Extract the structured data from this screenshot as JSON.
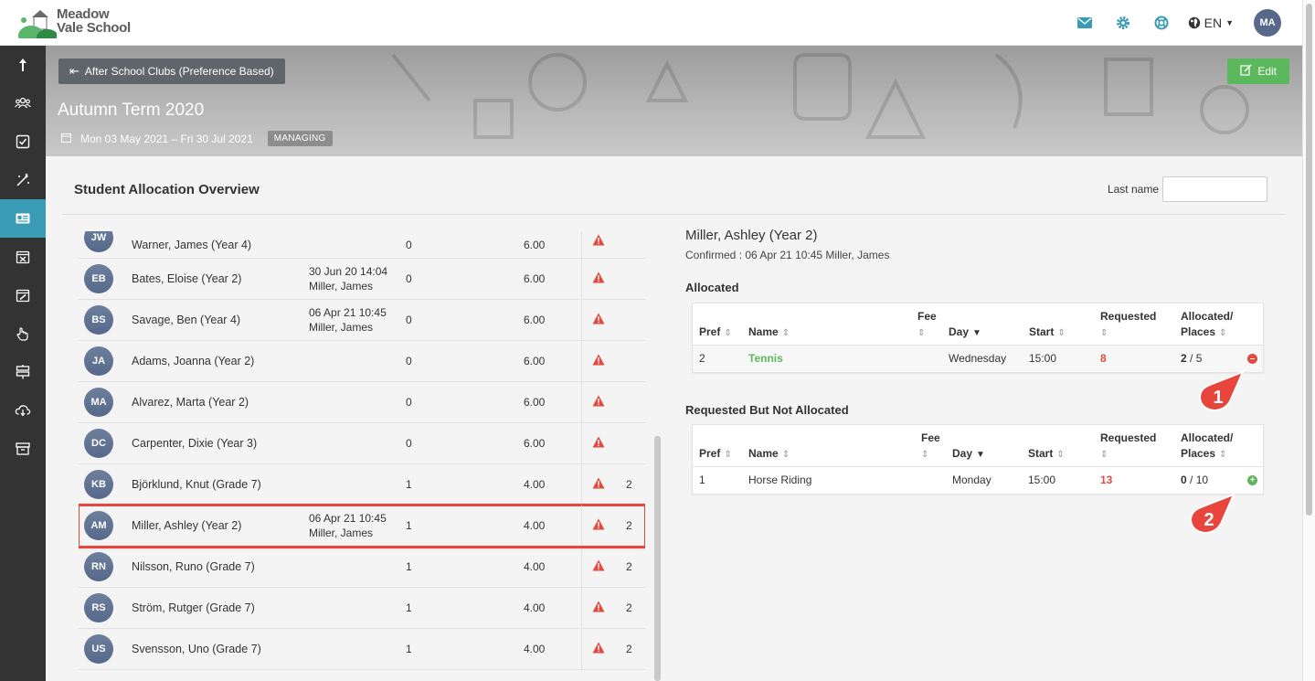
{
  "header": {
    "logo_line1": "Meadow",
    "logo_line2": "Vale School",
    "language": "EN",
    "user_initials": "MA"
  },
  "banner": {
    "back_label": "After School Clubs (Preference Based)",
    "edit_label": "Edit",
    "title": "Autumn Term 2020",
    "date_range": "Mon 03 May 2021 – Fri 30 Jul 2021",
    "status_badge": "MANAGING"
  },
  "overview": {
    "title": "Student Allocation Overview",
    "filter_label": "Last name",
    "filter_value": ""
  },
  "students": [
    {
      "initials": "JW",
      "name": "Warner, James (Year 4)",
      "confirmed_date": "",
      "confirmed_by": "",
      "allocated": "0",
      "fee": "6.00",
      "extra": ""
    },
    {
      "initials": "EB",
      "name": "Bates, Eloise (Year 2)",
      "confirmed_date": "30 Jun 20 14:04",
      "confirmed_by": "Miller, James",
      "allocated": "0",
      "fee": "6.00",
      "extra": ""
    },
    {
      "initials": "BS",
      "name": "Savage, Ben (Year 4)",
      "confirmed_date": "06 Apr 21 10:45",
      "confirmed_by": "Miller, James",
      "allocated": "0",
      "fee": "6.00",
      "extra": ""
    },
    {
      "initials": "JA",
      "name": "Adams, Joanna (Year 2)",
      "confirmed_date": "",
      "confirmed_by": "",
      "allocated": "0",
      "fee": "6.00",
      "extra": ""
    },
    {
      "initials": "MA",
      "name": "Alvarez, Marta (Year 2)",
      "confirmed_date": "",
      "confirmed_by": "",
      "allocated": "0",
      "fee": "6.00",
      "extra": ""
    },
    {
      "initials": "DC",
      "name": "Carpenter, Dixie (Year 3)",
      "confirmed_date": "",
      "confirmed_by": "",
      "allocated": "0",
      "fee": "6.00",
      "extra": ""
    },
    {
      "initials": "KB",
      "name": "Björklund, Knut (Grade 7)",
      "confirmed_date": "",
      "confirmed_by": "",
      "allocated": "1",
      "fee": "4.00",
      "extra": "2"
    },
    {
      "initials": "AM",
      "name": "Miller, Ashley (Year 2)",
      "confirmed_date": "06 Apr 21 10:45",
      "confirmed_by": "Miller, James",
      "allocated": "1",
      "fee": "4.00",
      "extra": "2"
    },
    {
      "initials": "RN",
      "name": "Nilsson, Runo (Grade 7)",
      "confirmed_date": "",
      "confirmed_by": "",
      "allocated": "1",
      "fee": "4.00",
      "extra": "2"
    },
    {
      "initials": "RS",
      "name": "Ström, Rutger (Grade 7)",
      "confirmed_date": "",
      "confirmed_by": "",
      "allocated": "1",
      "fee": "4.00",
      "extra": "2"
    },
    {
      "initials": "US",
      "name": "Svensson, Uno (Grade 7)",
      "confirmed_date": "",
      "confirmed_by": "",
      "allocated": "1",
      "fee": "4.00",
      "extra": "2"
    }
  ],
  "selected_index": 7,
  "detail": {
    "student_name": "Miller, Ashley (Year 2)",
    "confirmed_text": "Confirmed : 06 Apr 21 10:45 Miller, James",
    "allocated_title": "Allocated",
    "not_allocated_title": "Requested But Not Allocated",
    "columns": {
      "pref": "Pref",
      "name": "Name",
      "fee": "Fee",
      "day": "Day",
      "start": "Start",
      "requested": "Requested",
      "allocated_places_1": "Allocated/",
      "allocated_places_2": "Places"
    },
    "allocated_row": {
      "pref": "2",
      "name": "Tennis",
      "day": "Wednesday",
      "start": "15:00",
      "requested": "8",
      "allocated": "2",
      "places": "/ 5"
    },
    "not_allocated_row": {
      "pref": "1",
      "name": "Horse Riding",
      "day": "Monday",
      "start": "15:00",
      "requested": "13",
      "allocated": "0",
      "places": "/ 10"
    }
  },
  "markers": [
    "1",
    "2"
  ],
  "colors": {
    "sidebar": "#333333",
    "sidebar_active": "#3a9bb5",
    "edit_green": "#5cb85c",
    "alert_red": "#e04a3f",
    "avatar": "#56698a",
    "header_icon": "#3a9bb5"
  },
  "icons": {
    "sidebar": [
      "upload-icon",
      "people-icon",
      "checkbox-icon",
      "magic-wand-icon",
      "id-card-icon",
      "calendar-x-icon",
      "calendar-edit-icon",
      "hand-pointer-icon",
      "signpost-icon",
      "cloud-download-icon",
      "archive-icon"
    ],
    "header": [
      "envelope-icon",
      "gear-icon",
      "lifebuoy-icon",
      "globe-icon"
    ]
  }
}
